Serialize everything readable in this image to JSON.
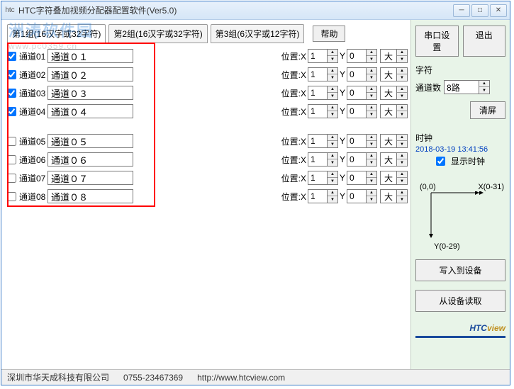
{
  "window": {
    "title": "HTC字符叠加视频分配器配置软件(Ver5.0)",
    "icon": "htc"
  },
  "tabs": [
    {
      "label": "第1组(16汉字或32字符)",
      "active": true
    },
    {
      "label": "第2组(16汉字或32字符)",
      "active": false
    },
    {
      "label": "第3组(6汉字或12字符)",
      "active": false
    }
  ],
  "help_label": "帮助",
  "channels": [
    {
      "checked": true,
      "label": "通道01",
      "value": "通道０１",
      "pos_label": "位置:X",
      "x": "1",
      "y_label": "Y",
      "y": "0",
      "size": "大"
    },
    {
      "checked": true,
      "label": "通道02",
      "value": "通道０２",
      "pos_label": "位置:X",
      "x": "1",
      "y_label": "Y",
      "y": "0",
      "size": "大"
    },
    {
      "checked": true,
      "label": "通道03",
      "value": "通道０３",
      "pos_label": "位置:X",
      "x": "1",
      "y_label": "Y",
      "y": "0",
      "size": "大"
    },
    {
      "checked": true,
      "label": "通道04",
      "value": "通道０４",
      "pos_label": "位置:X",
      "x": "1",
      "y_label": "Y",
      "y": "0",
      "size": "大"
    },
    {
      "checked": false,
      "label": "通道05",
      "value": "通道０５",
      "pos_label": "位置:X",
      "x": "1",
      "y_label": "Y",
      "y": "0",
      "size": "大"
    },
    {
      "checked": false,
      "label": "通道06",
      "value": "通道０６",
      "pos_label": "位置:X",
      "x": "1",
      "y_label": "Y",
      "y": "0",
      "size": "大"
    },
    {
      "checked": false,
      "label": "通道07",
      "value": "通道０７",
      "pos_label": "位置:X",
      "x": "1",
      "y_label": "Y",
      "y": "0",
      "size": "大"
    },
    {
      "checked": false,
      "label": "通道08",
      "value": "通道０８",
      "pos_label": "位置:X",
      "x": "1",
      "y_label": "Y",
      "y": "0",
      "size": "大"
    }
  ],
  "sidebar": {
    "serial_btn": "串口设置",
    "exit_btn": "退出",
    "char_section": "字符",
    "chcount_label": "通道数",
    "chcount_value": "8路",
    "clear_btn": "清屏",
    "clock_section": "时钟",
    "clock_time": "2018-03-19 13:41:56",
    "show_clock_label": "显示时钟",
    "show_clock_checked": true,
    "coord_origin": "(0,0)",
    "coord_x": "X(0-31)",
    "coord_y": "Y(0-29)",
    "write_btn": "写入到设备",
    "read_btn": "从设备读取",
    "logo_main": "HTC",
    "logo_sub": "view"
  },
  "status": {
    "company": "深圳市华天成科技有限公司",
    "phone": "0755-23467369",
    "url": "http://www.htcview.com"
  },
  "watermark": {
    "line1": "洲涛软件园",
    "line2": "www.pc0359.cn"
  }
}
